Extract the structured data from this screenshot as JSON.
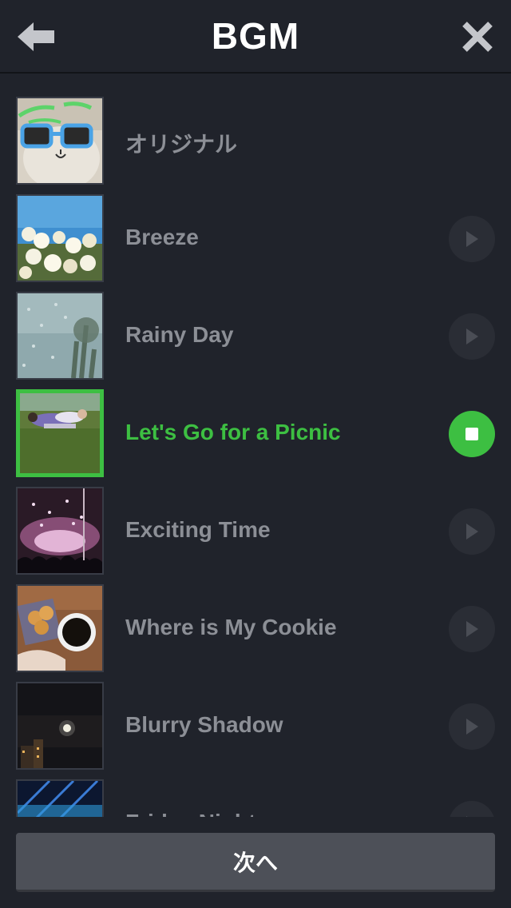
{
  "header": {
    "title": "BGM",
    "back_icon": "arrow-left-icon",
    "close_icon": "close-icon"
  },
  "colors": {
    "background": "#20232b",
    "accent": "#3dbf42",
    "text_muted": "#8c8f96",
    "button": "#4d5058"
  },
  "tracks": [
    {
      "name": "オリジナル",
      "playing": false,
      "has_play_button": false
    },
    {
      "name": "Breeze",
      "playing": false,
      "has_play_button": true
    },
    {
      "name": "Rainy Day",
      "playing": false,
      "has_play_button": true
    },
    {
      "name": "Let's Go for a Picnic",
      "playing": true,
      "has_play_button": true
    },
    {
      "name": "Exciting Time",
      "playing": false,
      "has_play_button": true
    },
    {
      "name": "Where is My Cookie",
      "playing": false,
      "has_play_button": true
    },
    {
      "name": "Blurry Shadow",
      "playing": false,
      "has_play_button": true
    },
    {
      "name": "Friday Night",
      "playing": false,
      "has_play_button": true
    }
  ],
  "footer": {
    "next_label": "次へ"
  }
}
